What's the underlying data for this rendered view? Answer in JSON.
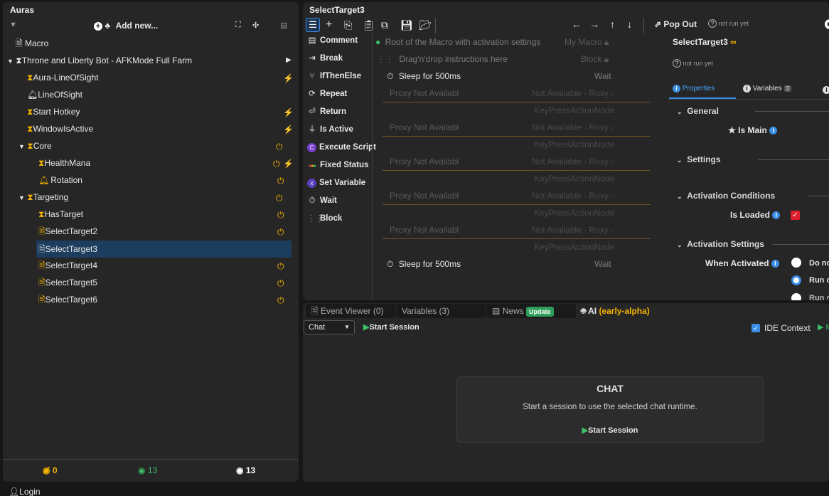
{
  "auras": {
    "title": "Auras",
    "add_new_label": "Add new...",
    "tree": [
      {
        "label": "Macro",
        "icon": "file-icon"
      },
      {
        "label": "Throne and Liberty Bot - AFKMode Full Farm",
        "icon": "hourglass-icon"
      },
      {
        "label": "Aura-LineOfSight",
        "icon": "hourglass-icon"
      },
      {
        "label": "LineOfSight",
        "icon": "bell-icon"
      },
      {
        "label": "Start Hotkey",
        "icon": "hourglass-icon"
      },
      {
        "label": "WindowIsActive",
        "icon": "hourglass-icon"
      },
      {
        "label": "Core",
        "icon": "hourglass-icon"
      },
      {
        "label": "HealthMana",
        "icon": "hourglass-icon"
      },
      {
        "label": "Rotation",
        "icon": "bell-icon"
      },
      {
        "label": "Targeting",
        "icon": "hourglass-icon"
      },
      {
        "label": "HasTarget",
        "icon": "hourglass-icon"
      },
      {
        "label": "SelectTarget2",
        "icon": "file-icon"
      },
      {
        "label": "SelectTarget3",
        "icon": "file-icon"
      },
      {
        "label": "SelectTarget4",
        "icon": "file-icon"
      },
      {
        "label": "SelectTarget5",
        "icon": "file-icon"
      },
      {
        "label": "SelectTarget6",
        "icon": "file-icon"
      }
    ],
    "footer": {
      "hidden_count": "0",
      "visible_count": "13",
      "total_count": "13"
    }
  },
  "login_label": "Login",
  "editor": {
    "title": "SelectTarget3",
    "pop_out_label": "Pop Out",
    "status": "not run yet",
    "commands": [
      "Comment",
      "Break",
      "IfThenElse",
      "Repeat",
      "Return",
      "Is Active",
      "Execute Script",
      "Fixed Status",
      "Set Variable",
      "Wait",
      "Block"
    ],
    "root_text": "Root of the Macro with activation settings",
    "root_right": "My Macro",
    "drag_text": "Drag'n'drop instructions here",
    "drag_right": "Block",
    "sleep_label": "Sleep for 500ms",
    "sleep_right": "Wait",
    "proxy_text": "Proxy Not Availabl",
    "proxy_right": "Not Available - Roxy -",
    "keypress_text": "KeyPressActionNode"
  },
  "properties": {
    "title": "SelectTarget3",
    "status": "not run yet",
    "tabs": [
      "Properties",
      "Variables",
      "3"
    ],
    "general_label": "General",
    "is_main_label": "Is Main",
    "settings_label": "Settings",
    "activation_conditions_label": "Activation Conditions",
    "is_loaded_label": "Is Loaded",
    "activation_settings_label": "Activation Settings",
    "when_activated_label": "When Activated",
    "radio_options": [
      "Do no",
      "Run o",
      "Run o"
    ]
  },
  "bottom": {
    "tabs": {
      "event_viewer": "Event Viewer (0)",
      "variables": "Variables (3)",
      "news": "News",
      "update_badge": "Update",
      "ai": "AI",
      "ai_note": "(early-alpha)"
    },
    "chat_select": "Chat",
    "start_session": "Start Session",
    "ide_context": "IDE Context",
    "chat_card": {
      "title": "CHAT",
      "message": "Start a session to use the selected chat runtime.",
      "button": "Start Session"
    }
  },
  "colors": {
    "accent": "#3a8ee6",
    "yellow": "#f5b400",
    "green": "#3cc068",
    "selected_row": "#1d3d5e"
  }
}
